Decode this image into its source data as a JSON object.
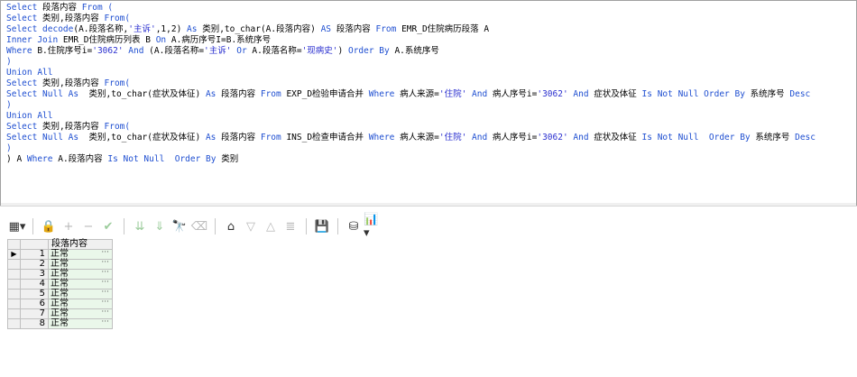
{
  "editor": {
    "lines": [
      [
        [
          "kw",
          "Select "
        ],
        [
          "txt",
          "段落内容 "
        ],
        [
          "kw",
          "From ("
        ]
      ],
      [
        [
          "kw",
          "Select "
        ],
        [
          "txt",
          "类别,段落内容 "
        ],
        [
          "kw",
          "From("
        ]
      ],
      [
        [
          "kw",
          "Select decode"
        ],
        [
          "txt",
          "(A.段落名称,"
        ],
        [
          "str",
          "'主诉'"
        ],
        [
          "txt",
          ",1,2) "
        ],
        [
          "kw",
          "As "
        ],
        [
          "txt",
          "类别,to_char(A.段落内容) "
        ],
        [
          "kw",
          "AS "
        ],
        [
          "txt",
          "段落内容 "
        ],
        [
          "kw",
          "From "
        ],
        [
          "txt",
          "EMR_D住院病历段落 A"
        ]
      ],
      [
        [
          "kw",
          "Inner Join "
        ],
        [
          "txt",
          "EMR_D住院病历列表 B "
        ],
        [
          "kw",
          "On "
        ],
        [
          "txt",
          "A.病历序号I=B.系统序号"
        ]
      ],
      [
        [
          "kw",
          "Where "
        ],
        [
          "txt",
          "B.住院序号i="
        ],
        [
          "str",
          "'3062'"
        ],
        [
          "kw",
          " And "
        ],
        [
          "txt",
          "(A.段落名称="
        ],
        [
          "str",
          "'主诉'"
        ],
        [
          "kw",
          " Or "
        ],
        [
          "txt",
          "A.段落名称="
        ],
        [
          "str",
          "'现病史'"
        ],
        [
          "txt",
          ") "
        ],
        [
          "kw",
          "Order By "
        ],
        [
          "txt",
          "A.系统序号"
        ]
      ],
      [
        [
          "kw",
          ")"
        ]
      ],
      [
        [
          "kw",
          "Union All"
        ]
      ],
      [
        [
          "kw",
          "Select "
        ],
        [
          "txt",
          "类别,段落内容 "
        ],
        [
          "kw",
          "From("
        ]
      ],
      [
        [
          "kw",
          "Select Null As  "
        ],
        [
          "txt",
          "类别,to_char(症状及体征) "
        ],
        [
          "kw",
          "As "
        ],
        [
          "txt",
          "段落内容 "
        ],
        [
          "kw",
          "From "
        ],
        [
          "txt",
          "EXP_D检验申请合并 "
        ],
        [
          "kw",
          "Where "
        ],
        [
          "txt",
          "病人来源="
        ],
        [
          "str",
          "'住院'"
        ],
        [
          "kw",
          " And "
        ],
        [
          "txt",
          "病人序号i="
        ],
        [
          "str",
          "'3062'"
        ],
        [
          "kw",
          " And "
        ],
        [
          "txt",
          "症状及体征 "
        ],
        [
          "kw",
          "Is Not Null Order By "
        ],
        [
          "txt",
          "系统序号 "
        ],
        [
          "kw",
          "Desc"
        ]
      ],
      [
        [
          "kw",
          ")"
        ]
      ],
      [
        [
          "kw",
          "Union All"
        ]
      ],
      [
        [
          "kw",
          "Select "
        ],
        [
          "txt",
          "类别,段落内容 "
        ],
        [
          "kw",
          "From("
        ]
      ],
      [
        [
          "kw",
          "Select Null As  "
        ],
        [
          "txt",
          "类别,to_char(症状及体征) "
        ],
        [
          "kw",
          "As "
        ],
        [
          "txt",
          "段落内容 "
        ],
        [
          "kw",
          "From "
        ],
        [
          "txt",
          "INS_D检查申请合并 "
        ],
        [
          "kw",
          "Where "
        ],
        [
          "txt",
          "病人来源="
        ],
        [
          "str",
          "'住院'"
        ],
        [
          "kw",
          " And "
        ],
        [
          "txt",
          "病人序号i="
        ],
        [
          "str",
          "'3062'"
        ],
        [
          "kw",
          " And "
        ],
        [
          "txt",
          "症状及体征 "
        ],
        [
          "kw",
          "Is Not Null  Order By "
        ],
        [
          "txt",
          "系统序号 "
        ],
        [
          "kw",
          "Desc"
        ]
      ],
      [
        [
          "kw",
          ")"
        ]
      ],
      [
        [
          "txt",
          ") A "
        ],
        [
          "kw",
          "Where "
        ],
        [
          "txt",
          "A.段落内容 "
        ],
        [
          "kw",
          "Is Not Null  Order By "
        ],
        [
          "txt",
          "类别"
        ]
      ]
    ]
  },
  "toolbar": {
    "icons": [
      "grid-menu-icon",
      "lock-icon",
      "add-icon",
      "remove-icon",
      "check-icon",
      "sort-down-icon",
      "sort-down-all-icon",
      "find-icon",
      "clear-icon",
      "query-icon",
      "filter-down-icon",
      "filter-up-icon",
      "chart-icon",
      "save-icon",
      "export-icon",
      "report-icon"
    ]
  },
  "grid": {
    "column": "段落内容",
    "rows": [
      {
        "num": "1",
        "value": "正常"
      },
      {
        "num": "2",
        "value": "正常"
      },
      {
        "num": "3",
        "value": "正常"
      },
      {
        "num": "4",
        "value": "正常"
      },
      {
        "num": "5",
        "value": "正常"
      },
      {
        "num": "6",
        "value": "正常"
      },
      {
        "num": "7",
        "value": "正常"
      },
      {
        "num": "8",
        "value": "正常"
      }
    ],
    "ellipsis": "···",
    "indicator": "▶"
  }
}
